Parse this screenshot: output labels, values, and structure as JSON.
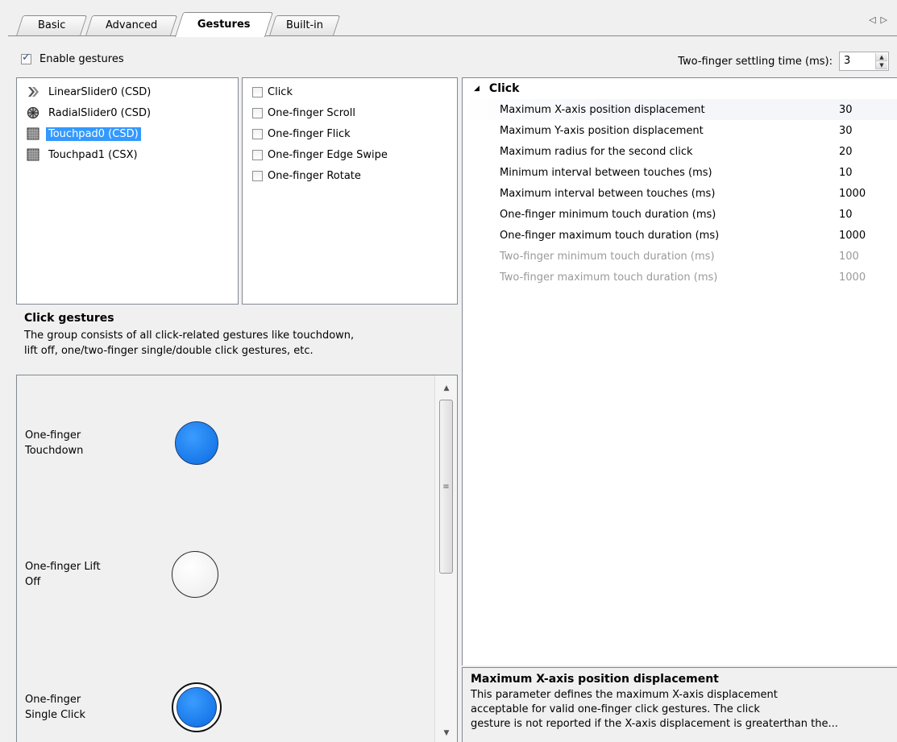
{
  "tabs": [
    {
      "label": "Basic",
      "active": false
    },
    {
      "label": "Advanced",
      "active": false
    },
    {
      "label": "Gestures",
      "active": true
    },
    {
      "label": "Built-in",
      "active": false
    }
  ],
  "tab_nav": {
    "prev": "◁",
    "next": "▷"
  },
  "enable_gestures": {
    "label": "Enable gestures",
    "checked": true
  },
  "settling": {
    "label": "Two-finger settling time (ms):",
    "value": "3"
  },
  "sensors": [
    {
      "label": "LinearSlider0 (CSD)",
      "icon": "linear-slider-icon",
      "selected": false
    },
    {
      "label": "RadialSlider0 (CSD)",
      "icon": "radial-slider-icon",
      "selected": false
    },
    {
      "label": "Touchpad0 (CSD)",
      "icon": "touchpad-icon",
      "selected": true
    },
    {
      "label": "Touchpad1 (CSX)",
      "icon": "touchpad-icon",
      "selected": false
    }
  ],
  "gestures": [
    {
      "label": "Click",
      "checked": false
    },
    {
      "label": "One-finger Scroll",
      "checked": false
    },
    {
      "label": "One-finger Flick",
      "checked": false
    },
    {
      "label": "One-finger Edge Swipe",
      "checked": false
    },
    {
      "label": "One-finger Rotate",
      "checked": false
    }
  ],
  "group": {
    "title": "Click gestures",
    "line1": "The group consists of all click-related gestures like touchdown,",
    "line2": "lift off, one/two-finger single/double click gestures, etc."
  },
  "animations": [
    {
      "line1": "One-finger",
      "line2": "Touchdown"
    },
    {
      "line1": "One-finger Lift",
      "line2": "Off"
    },
    {
      "line1": "One-finger",
      "line2": "Single Click"
    }
  ],
  "properties": {
    "category": "Click",
    "rows": [
      {
        "name": "Maximum X-axis position displacement",
        "value": "30",
        "enabled": true
      },
      {
        "name": "Maximum Y-axis position displacement",
        "value": "30",
        "enabled": true
      },
      {
        "name": "Maximum radius for the second click",
        "value": "20",
        "enabled": true
      },
      {
        "name": "Minimum interval between touches (ms)",
        "value": "10",
        "enabled": true
      },
      {
        "name": "Maximum interval between touches (ms)",
        "value": "1000",
        "enabled": true
      },
      {
        "name": "One-finger minimum touch duration (ms)",
        "value": "10",
        "enabled": true
      },
      {
        "name": "One-finger maximum touch duration (ms)",
        "value": "1000",
        "enabled": true
      },
      {
        "name": "Two-finger minimum touch duration (ms)",
        "value": "100",
        "enabled": false
      },
      {
        "name": "Two-finger maximum touch duration (ms)",
        "value": "1000",
        "enabled": false
      }
    ]
  },
  "property_desc": {
    "title": "Maximum X-axis position displacement",
    "line1": "This parameter defines the maximum X-axis displacement",
    "line2": "acceptable for valid one-finger click gestures. The click",
    "line3": "gesture is not reported if the X-axis displacement is greaterthan the..."
  },
  "colors": {
    "selection": "#3399ff",
    "touch_blue": "#0a6ae0"
  }
}
